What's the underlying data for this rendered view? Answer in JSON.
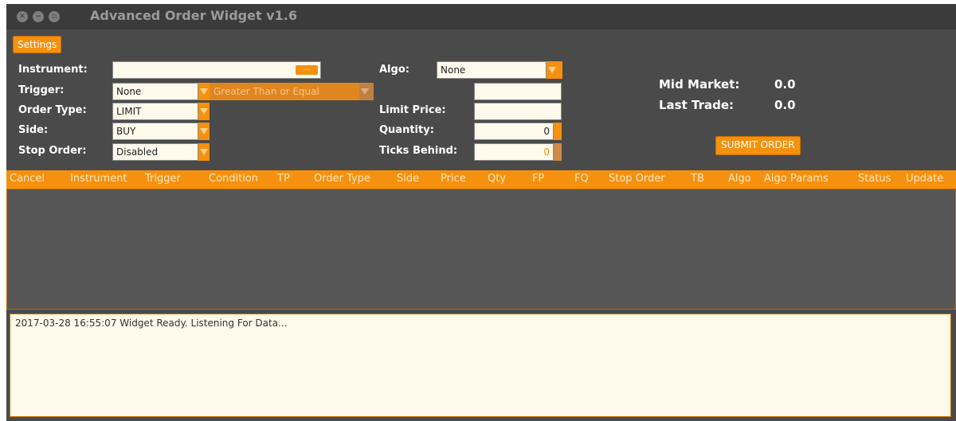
{
  "window": {
    "title": "Advanced Order Widget v1.6"
  },
  "toolbar": {
    "settings_label": "Settings"
  },
  "form": {
    "instrument": {
      "label": "Instrument:",
      "value": "",
      "browse": "..."
    },
    "trigger": {
      "label": "Trigger:",
      "value": "None",
      "condition": "Greater Than or Equal",
      "condition_value": ""
    },
    "order_type": {
      "label": "Order Type:",
      "value": "LIMIT"
    },
    "side": {
      "label": "Side:",
      "value": "BUY"
    },
    "stop_order": {
      "label": "Stop Order:",
      "value": "Disabled"
    },
    "algo": {
      "label": "Algo:",
      "value": "None"
    },
    "limit_price": {
      "label": "Limit Price:",
      "value": ""
    },
    "quantity": {
      "label": "Quantity:",
      "value": "0"
    },
    "ticks_behind": {
      "label": "Ticks Behind:",
      "value": "0"
    }
  },
  "market": {
    "mid_label": "Mid Market:",
    "mid_value": "0.0",
    "last_label": "Last Trade:",
    "last_value": "0.0",
    "submit_label": "SUBMIT ORDER"
  },
  "table": {
    "columns": [
      "Cancel",
      "Instrument",
      "Trigger",
      "Condition",
      "TP",
      "Order Type",
      "Side",
      "Price",
      "Qty",
      "FP",
      "FQ",
      "Stop Order",
      "TB",
      "Algo",
      "Algo Params",
      "Status",
      "Update"
    ],
    "rows": []
  },
  "log": {
    "text": "2017-03-28 16:55:07 Widget Ready. Listening For Data..."
  },
  "colors": {
    "accent": "#f5910e",
    "background": "#4a4a4a",
    "field": "#fffaec"
  }
}
